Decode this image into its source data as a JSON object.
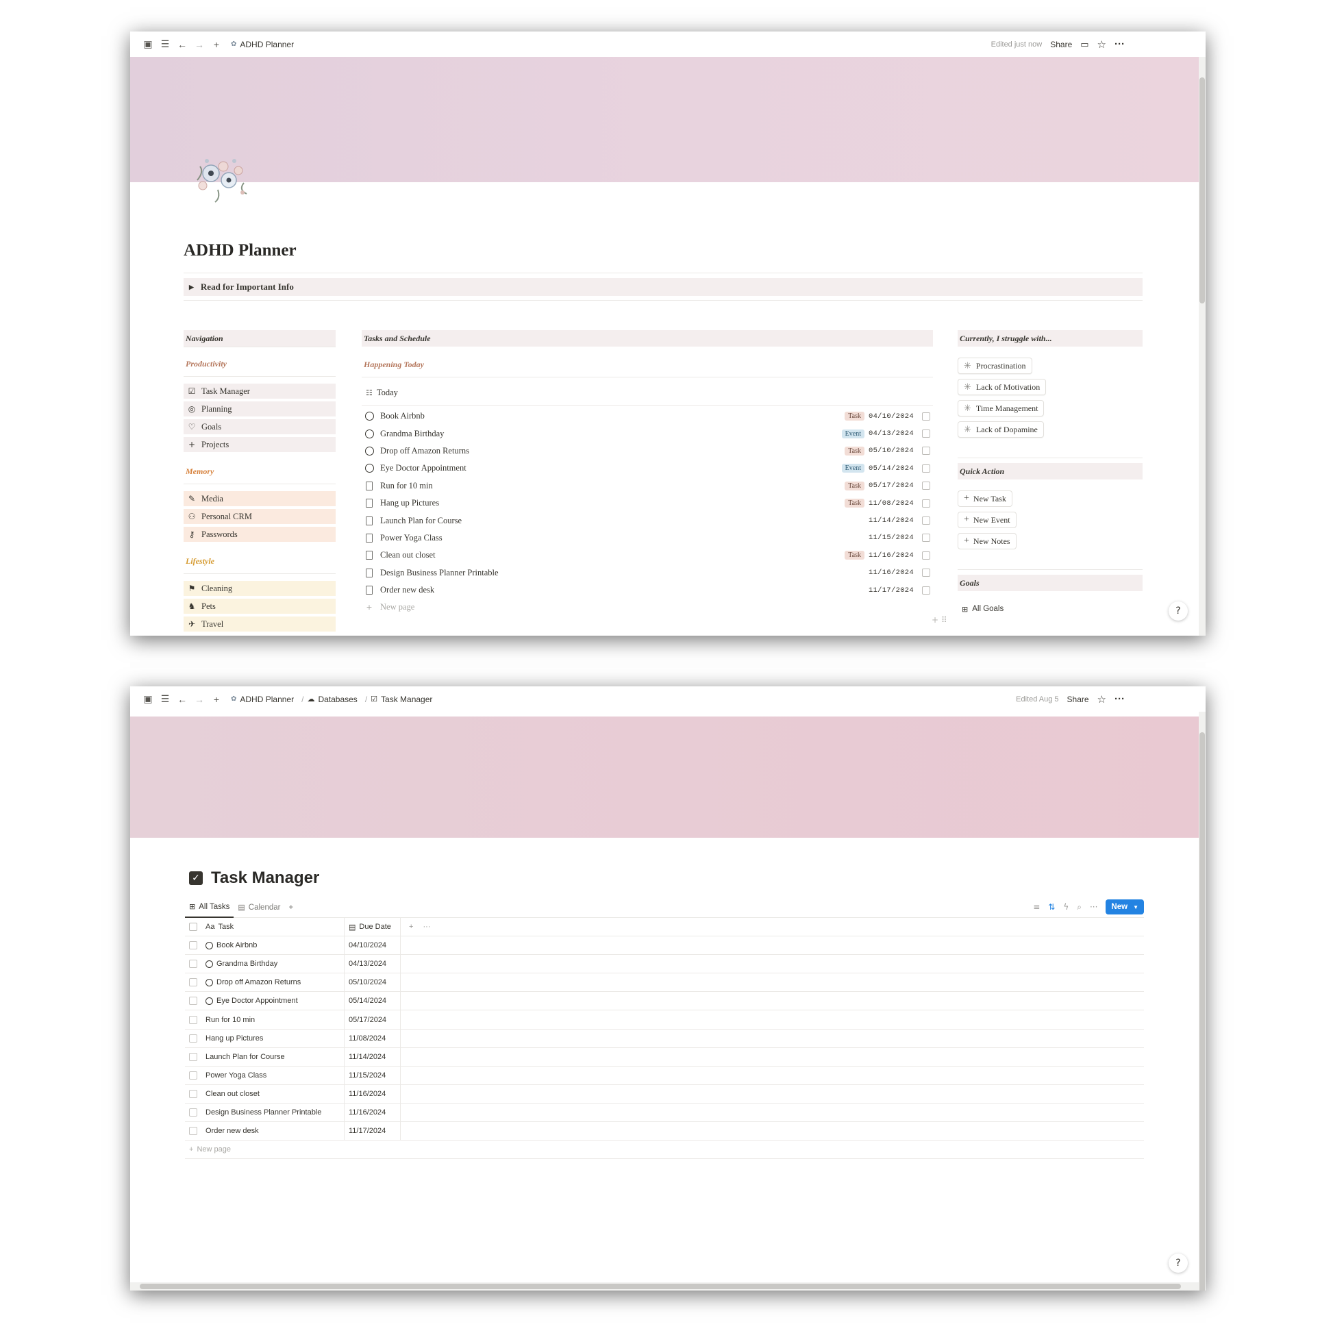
{
  "window1": {
    "breadcrumb": [
      "ADHD Planner"
    ],
    "edited": "Edited just now",
    "share": "Share",
    "title": "ADHD Planner",
    "toggle_label": "Read for Important Info",
    "navigation": {
      "heading": "Navigation",
      "sections": [
        {
          "label": "Productivity",
          "color": "#b5775c",
          "bg": "#f4eeee",
          "items": [
            {
              "label": "Task Manager",
              "icon": "checklist-icon",
              "glyph": "☑"
            },
            {
              "label": "Planning",
              "icon": "target-icon",
              "glyph": "◎"
            },
            {
              "label": "Goals",
              "icon": "heart-icon",
              "glyph": "♡"
            },
            {
              "label": "Projects",
              "icon": "plus-icon",
              "glyph": "+"
            }
          ]
        },
        {
          "label": "Memory",
          "color": "#d7833e",
          "bg": "#fbeadf",
          "items": [
            {
              "label": "Media",
              "icon": "paperclip-icon",
              "glyph": "✎"
            },
            {
              "label": "Personal CRM",
              "icon": "add-person-icon",
              "glyph": "⚇"
            },
            {
              "label": "Passwords",
              "icon": "key-icon",
              "glyph": "⚷"
            }
          ]
        },
        {
          "label": "Lifestyle",
          "color": "#d59a2f",
          "bg": "#fbf3df",
          "items": [
            {
              "label": "Cleaning",
              "icon": "broom-icon",
              "glyph": "⚑"
            },
            {
              "label": "Pets",
              "icon": "dog-icon",
              "glyph": "♞"
            },
            {
              "label": "Travel",
              "icon": "plane-icon",
              "glyph": "✈"
            }
          ]
        }
      ]
    },
    "tasks": {
      "heading": "Tasks and Schedule",
      "subheading": "Happening Today",
      "view": "Today",
      "rows": [
        {
          "name": "Book Airbnb",
          "icon": "circle",
          "tag": "Task",
          "date": "04/10/2024"
        },
        {
          "name": "Grandma Birthday",
          "icon": "circle",
          "tag": "Event",
          "date": "04/13/2024"
        },
        {
          "name": "Drop off Amazon Returns",
          "icon": "circle",
          "tag": "Task",
          "date": "05/10/2024"
        },
        {
          "name": "Eye Doctor Appointment",
          "icon": "circle",
          "tag": "Event",
          "date": "05/14/2024"
        },
        {
          "name": "Run for 10 min",
          "icon": "doc",
          "tag": "Task",
          "date": "05/17/2024"
        },
        {
          "name": "Hang up Pictures",
          "icon": "doc",
          "tag": "Task",
          "date": "11/08/2024"
        },
        {
          "name": "Launch Plan for Course",
          "icon": "doc",
          "tag": "",
          "date": "11/14/2024"
        },
        {
          "name": "Power Yoga Class",
          "icon": "doc",
          "tag": "",
          "date": "11/15/2024"
        },
        {
          "name": "Clean out closet",
          "icon": "doc",
          "tag": "Task",
          "date": "11/16/2024"
        },
        {
          "name": "Design Business Planner Printable",
          "icon": "doc",
          "tag": "",
          "date": "11/16/2024"
        },
        {
          "name": "Order new desk",
          "icon": "doc",
          "tag": "",
          "date": "11/17/2024"
        }
      ],
      "new_page": "New page"
    },
    "right": {
      "struggle_heading": "Currently, I struggle with...",
      "struggles": [
        "Procrastination",
        "Lack of Motivation",
        "Time Management",
        "Lack of Dopamine"
      ],
      "quick_heading": "Quick Action",
      "quick_actions": [
        "New Task",
        "New Event",
        "New Notes"
      ],
      "goals_heading": "Goals",
      "goals_view": "All Goals"
    }
  },
  "window2": {
    "breadcrumb": [
      "ADHD Planner",
      "Databases",
      "Task Manager"
    ],
    "edited": "Edited Aug 5",
    "share": "Share",
    "title": "Task Manager",
    "tabs": [
      "All Tasks",
      "Calendar"
    ],
    "new_button": "New",
    "columns": [
      "Task",
      "Due Date"
    ],
    "rows": [
      {
        "name": "Book Airbnb",
        "circle": true,
        "date": "04/10/2024"
      },
      {
        "name": "Grandma Birthday",
        "circle": true,
        "date": "04/13/2024"
      },
      {
        "name": "Drop off Amazon Returns",
        "circle": true,
        "date": "05/10/2024"
      },
      {
        "name": "Eye Doctor Appointment",
        "circle": true,
        "date": "05/14/2024"
      },
      {
        "name": "Run for 10 min",
        "circle": false,
        "date": "05/17/2024"
      },
      {
        "name": "Hang up Pictures",
        "circle": false,
        "date": "11/08/2024"
      },
      {
        "name": "Launch Plan for Course",
        "circle": false,
        "date": "11/14/2024"
      },
      {
        "name": "Power Yoga Class",
        "circle": false,
        "date": "11/15/2024"
      },
      {
        "name": "Clean out closet",
        "circle": false,
        "date": "11/16/2024"
      },
      {
        "name": "Design Business Planner Printable",
        "circle": false,
        "date": "11/16/2024"
      },
      {
        "name": "Order new desk",
        "circle": false,
        "date": "11/17/2024"
      }
    ],
    "new_page": "New page"
  }
}
